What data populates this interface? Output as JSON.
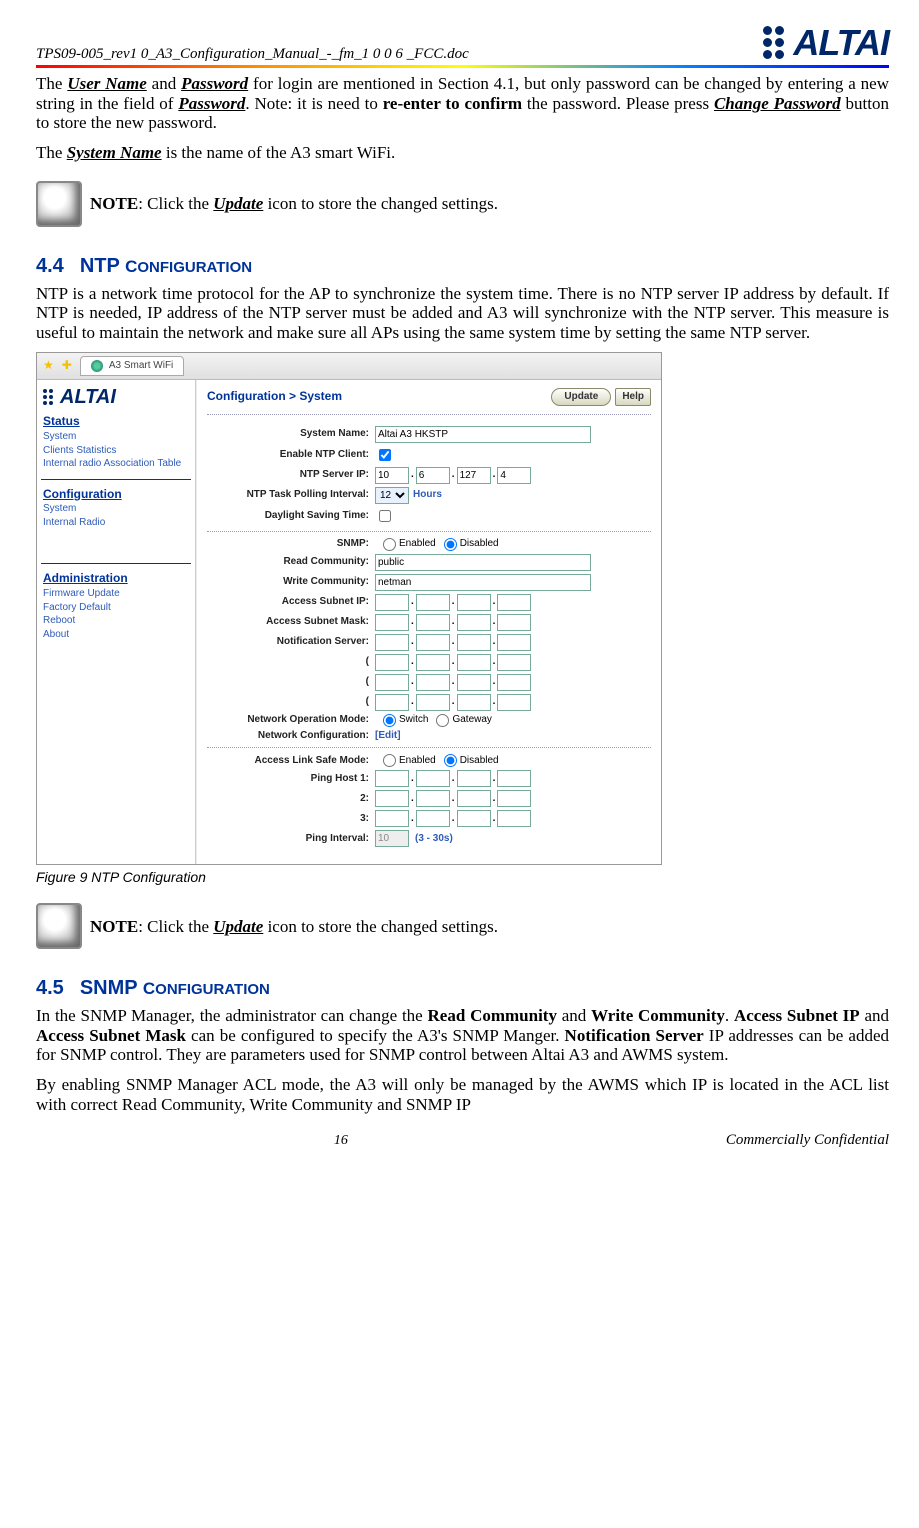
{
  "header": {
    "docname": "TPS09-005_rev1 0_A3_Configuration_Manual_-_fm_1 0 0 6 _FCC.doc",
    "logo": "ALTAI"
  },
  "p1": {
    "t1": "The ",
    "username": "User Name",
    "t2": " and ",
    "password": "Password",
    "t3": " for login are mentioned in Section 4.1, but only password can be changed by entering a new string in the field of ",
    "password2": "Password",
    "t4": ".   Note: it is need to ",
    "reenter": "re-enter to confirm",
    "t5": " the password. Please press ",
    "chpw": "Change Password",
    "t6": " button to store the new password."
  },
  "p2": {
    "t1": "The ",
    "sysname": "System Name",
    "t2": " is the name of the A3 smart WiFi."
  },
  "note": {
    "label": "NOTE",
    "t1": ": Click the ",
    "update": "Update",
    "t2": " icon to store the changed settings."
  },
  "sec44": {
    "num": "4.4",
    "title": "NTP CONFIGURATION"
  },
  "p3": "NTP is a network time protocol for the AP to synchronize the system time. There is no NTP server IP address by default. If NTP is needed, IP address of the NTP server must be added and A3 will synchronize with the NTP server. This measure is useful to maintain the network and make sure all APs using the same system time by setting the same NTP server.",
  "figcap": "Figure 9     NTP Configuration",
  "sec45": {
    "num": "4.5",
    "title": "SNMP CONFIGURATION"
  },
  "p4": {
    "t1": "In the SNMP Manager, the administrator can change the ",
    "rc": "Read Community",
    "t2": " and ",
    "wc": "Write Community",
    "t3": ". ",
    "asip": "Access Subnet IP",
    "t4": " and ",
    "asm": "Access Subnet Mask",
    "t5": " can be configured to specify the A3's SNMP Manger. ",
    "ns": "Notification Server",
    "t6": " IP addresses can be added for SNMP control. They are parameters used for SNMP control between Altai A3 and AWMS system."
  },
  "p5": "By enabling SNMP Manager ACL mode, the A3 will only be managed by the AWMS which IP is located in the ACL list with correct Read Community, Write Community and SNMP IP",
  "footer": {
    "page": "16",
    "conf": "Commercially Confidential"
  },
  "ss": {
    "tab": "A3 Smart WiFi",
    "breadcrumb": "Configuration >  System",
    "btn_update": "Update",
    "btn_help": "Help",
    "sidebar": {
      "status": "Status",
      "s1": "System",
      "s2": "Clients Statistics",
      "s3": "Internal radio Association Table",
      "config": "Configuration",
      "c1": "System",
      "c2": "Internal Radio",
      "admin": "Administration",
      "a1": "Firmware Update",
      "a2": "Factory Default",
      "a3": "Reboot",
      "a4": "About"
    },
    "form": {
      "sysname_lbl": "System Name:",
      "sysname_val": "Altai A3 HKSTP",
      "ntp_en_lbl": "Enable NTP Client:",
      "ntp_ip_lbl": "NTP Server IP:",
      "ntp_ip": [
        "10",
        "6",
        "127",
        "4"
      ],
      "ntp_poll_lbl": "NTP Task Polling Interval:",
      "ntp_poll_val": "12",
      "ntp_poll_unit": "Hours",
      "dst_lbl": "Daylight Saving Time:",
      "snmp_lbl": "SNMP:",
      "enabled": "Enabled",
      "disabled": "Disabled",
      "rc_lbl": "Read Community:",
      "rc_val": "public",
      "wc_lbl": "Write Community:",
      "wc_val": "netman",
      "asip_lbl": "Access Subnet IP:",
      "asm_lbl": "Access Subnet Mask:",
      "ns_lbl": "Notification Server:",
      "paren": "(",
      "nom_lbl": "Network Operation Mode:",
      "switch": "Switch",
      "gateway": "Gateway",
      "nc_lbl": "Network Configuration:",
      "edit": "[Edit]",
      "als_lbl": "Access Link Safe Mode:",
      "ph1_lbl": "Ping Host 1:",
      "ph2_lbl": "2:",
      "ph3_lbl": "3:",
      "pi_lbl": "Ping Interval:",
      "pi_val": "10",
      "pi_range": "(3 - 30s)"
    }
  }
}
